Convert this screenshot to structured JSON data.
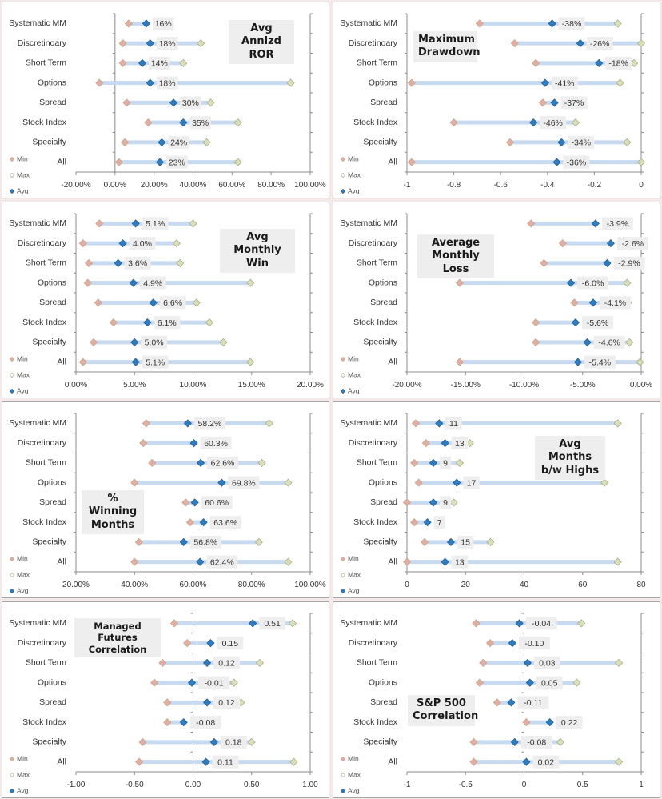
{
  "legend": {
    "min": "Min",
    "max": "Max",
    "avg": "Avg"
  },
  "colors": {
    "min": "#e3aea2",
    "min_edge": "#c9a58a",
    "max": "#d9e0b6",
    "max_edge": "#a8ad8c",
    "avg": "#2f7dbf",
    "range_bar": "#c8daf0",
    "axis": "#8c8c8c"
  },
  "chart_data": [
    {
      "id": "ror",
      "type": "scatter",
      "title": "Avg Annlzd ROR",
      "categories": [
        "Systematic MM",
        "Discretinoary",
        "Short Term",
        "Options",
        "Spread",
        "Stock Index",
        "Specialty",
        "All"
      ],
      "series": [
        {
          "name": "Min",
          "values": [
            0.07,
            0.04,
            0.04,
            -0.08,
            0.06,
            0.17,
            0.05,
            0.02
          ]
        },
        {
          "name": "Max",
          "values": [
            null,
            0.44,
            0.35,
            0.9,
            0.49,
            0.63,
            0.47,
            0.63
          ]
        },
        {
          "name": "Avg",
          "values": [
            0.16,
            0.18,
            0.14,
            0.18,
            0.3,
            0.35,
            0.24,
            0.23
          ]
        }
      ],
      "data_labels": [
        "16%",
        "18%",
        "14%",
        "18%",
        "30%",
        "35%",
        "24%",
        "23%"
      ],
      "xlim": [
        -0.2,
        1.0
      ],
      "ticks": [
        -0.2,
        0,
        0.2,
        0.4,
        0.6,
        0.8,
        1.0
      ],
      "tick_labels": [
        "-20.00%",
        "0.00%",
        "20.00%",
        "40.00%",
        "60.00%",
        "80.00%",
        "100.00%"
      ],
      "zero_line": true
    },
    {
      "id": "drawdown",
      "type": "scatter",
      "title": "Maximum Drawdown",
      "categories": [
        "Systematic MM",
        "Discretinoary",
        "Short Term",
        "Options",
        "Spread",
        "Stock Index",
        "Specialty",
        "All"
      ],
      "series": [
        {
          "name": "Min",
          "values": [
            -0.69,
            -0.54,
            -0.45,
            -0.98,
            -0.42,
            -0.8,
            -0.56,
            -0.98
          ]
        },
        {
          "name": "Max",
          "values": [
            -0.1,
            0.0,
            -0.03,
            -0.09,
            null,
            -0.28,
            -0.06,
            0.0
          ]
        },
        {
          "name": "Avg",
          "values": [
            -0.38,
            -0.26,
            -0.18,
            -0.41,
            -0.37,
            -0.46,
            -0.34,
            -0.36
          ]
        }
      ],
      "data_labels": [
        "-38%",
        "-26%",
        "-18%",
        "-41%",
        "-37%",
        "-46%",
        "-34%",
        "-36%"
      ],
      "xlim": [
        -1,
        0
      ],
      "ticks": [
        -1,
        -0.8,
        -0.6,
        -0.4,
        -0.2,
        0
      ],
      "tick_labels": [
        "-1",
        "-0.8",
        "-0.6",
        "-0.4",
        "-0.2",
        "0"
      ],
      "zero_line": false
    },
    {
      "id": "monthly_win",
      "type": "scatter",
      "title": "Avg Monthly Win",
      "categories": [
        "Systematic MM",
        "Discretinoary",
        "Short Term",
        "Options",
        "Spread",
        "Stock Index",
        "Specialty",
        "All"
      ],
      "series": [
        {
          "name": "Min",
          "values": [
            0.02,
            0.006,
            0.011,
            0.01,
            0.019,
            0.032,
            0.015,
            0.006
          ]
        },
        {
          "name": "Max",
          "values": [
            0.1,
            0.086,
            0.089,
            0.149,
            0.103,
            0.114,
            0.126,
            0.149
          ]
        },
        {
          "name": "Avg",
          "values": [
            0.051,
            0.04,
            0.036,
            0.049,
            0.066,
            0.061,
            0.05,
            0.051
          ]
        }
      ],
      "data_labels": [
        "5.1%",
        "4.0%",
        "3.6%",
        "4.9%",
        "6.6%",
        "6.1%",
        "5.0%",
        "5.1%"
      ],
      "xlim": [
        0,
        0.2
      ],
      "ticks": [
        0,
        0.05,
        0.1,
        0.15,
        0.2
      ],
      "tick_labels": [
        "0.00%",
        "5.00%",
        "10.00%",
        "15.00%",
        "20.00%"
      ],
      "zero_line": false
    },
    {
      "id": "monthly_loss",
      "type": "scatter",
      "title": "Average Monthly Loss",
      "categories": [
        "Systematic MM",
        "Discretinoary",
        "Short Term",
        "Options",
        "Spread",
        "Stock Index",
        "Specialty",
        "All"
      ],
      "series": [
        {
          "name": "Min",
          "values": [
            -0.094,
            -0.067,
            -0.083,
            -0.155,
            -0.057,
            -0.09,
            -0.09,
            -0.155
          ]
        },
        {
          "name": "Max",
          "values": [
            null,
            null,
            null,
            -0.012,
            -0.011,
            null,
            -0.01,
            -0.001
          ]
        },
        {
          "name": "Avg",
          "values": [
            -0.039,
            -0.026,
            -0.029,
            -0.06,
            -0.041,
            -0.056,
            -0.046,
            -0.054
          ]
        }
      ],
      "data_labels": [
        "-3.9%",
        "-2.6%",
        "-2.9%",
        "-6.0%",
        "-4.1%",
        "-5.6%",
        "-4.6%",
        "-5.4%"
      ],
      "xlim": [
        -0.2,
        0
      ],
      "ticks": [
        -0.2,
        -0.15,
        -0.1,
        -0.05,
        0
      ],
      "tick_labels": [
        "-20.00%",
        "-15.00%",
        "-10.00%",
        "-5.00%",
        "0.00%"
      ],
      "zero_line": false
    },
    {
      "id": "winning_months",
      "type": "scatter",
      "title": "% Winning Months",
      "categories": [
        "Systematic MM",
        "Discretinoary",
        "Short Term",
        "Options",
        "Spread",
        "Stock Index",
        "Specialty",
        "All"
      ],
      "series": [
        {
          "name": "Min",
          "values": [
            0.44,
            0.43,
            0.46,
            0.4,
            0.575,
            0.59,
            0.415,
            0.4
          ]
        },
        {
          "name": "Max",
          "values": [
            0.86,
            null,
            0.835,
            0.925,
            null,
            null,
            0.825,
            0.925
          ]
        },
        {
          "name": "Avg",
          "values": [
            0.582,
            0.603,
            0.626,
            0.698,
            0.606,
            0.636,
            0.568,
            0.624
          ]
        }
      ],
      "data_labels": [
        "58.2%",
        "60.3%",
        "62.6%",
        "69.8%",
        "60.6%",
        "63.6%",
        "56.8%",
        "62.4%"
      ],
      "xlim": [
        0.2,
        1.0
      ],
      "ticks": [
        0.2,
        0.4,
        0.6,
        0.8,
        1.0
      ],
      "tick_labels": [
        "20.00%",
        "40.00%",
        "60.00%",
        "80.00%",
        "100.00%"
      ],
      "zero_line": false
    },
    {
      "id": "months_between_highs",
      "type": "scatter",
      "title": "Avg Months b/w Highs",
      "categories": [
        "Systematic MM",
        "Discretinoary",
        "Short Term",
        "Options",
        "Spread",
        "Stock Index",
        "Specialty",
        "All"
      ],
      "series": [
        {
          "name": "Min",
          "values": [
            3,
            6.5,
            2.5,
            4,
            0,
            2.5,
            6,
            0
          ]
        },
        {
          "name": "Max",
          "values": [
            72,
            21.5,
            18,
            67.5,
            16,
            null,
            28.5,
            72
          ]
        },
        {
          "name": "Avg",
          "values": [
            11,
            13,
            9,
            17,
            9,
            7,
            15,
            13
          ]
        }
      ],
      "data_labels": [
        "11",
        "13",
        "9",
        "17",
        "9",
        "7",
        "15",
        "13"
      ],
      "xlim": [
        0,
        80
      ],
      "ticks": [
        0,
        20,
        40,
        60,
        80
      ],
      "tick_labels": [
        "0",
        "20",
        "40",
        "60",
        "80"
      ],
      "zero_line": false
    },
    {
      "id": "mf_correlation",
      "type": "scatter",
      "title": "Managed Futures Correlation",
      "categories": [
        "Systematic MM",
        "Discretinoary",
        "Short Term",
        "Options",
        "Spread",
        "Stock Index",
        "Specialty",
        "All"
      ],
      "series": [
        {
          "name": "Min",
          "values": [
            -0.16,
            -0.05,
            -0.26,
            -0.33,
            -0.22,
            -0.22,
            -0.43,
            -0.46
          ]
        },
        {
          "name": "Max",
          "values": [
            0.85,
            null,
            0.57,
            0.35,
            0.41,
            null,
            0.5,
            0.86
          ]
        },
        {
          "name": "Avg",
          "values": [
            0.51,
            0.15,
            0.12,
            -0.01,
            0.12,
            -0.08,
            0.18,
            0.11
          ]
        }
      ],
      "data_labels": [
        "0.51",
        "0.15",
        "0.12",
        "-0.01",
        "0.12",
        "-0.08",
        "0.18",
        "0.11"
      ],
      "xlim": [
        -1,
        1
      ],
      "ticks": [
        -1,
        -0.5,
        0,
        0.5,
        1
      ],
      "tick_labels": [
        "-1.00",
        "-0.50",
        "0.00",
        "0.50",
        "1.00"
      ],
      "zero_line": true
    },
    {
      "id": "sp500_correlation",
      "type": "scatter",
      "title": "S&P 500 Correlation",
      "categories": [
        "Systematic MM",
        "Discretinoary",
        "Short Term",
        "Options",
        "Spread",
        "Stock Index",
        "Specialty",
        "All"
      ],
      "series": [
        {
          "name": "Min",
          "values": [
            -0.41,
            -0.29,
            -0.35,
            -0.38,
            -0.23,
            0.02,
            -0.43,
            -0.43
          ]
        },
        {
          "name": "Max",
          "values": [
            0.49,
            null,
            0.81,
            0.45,
            null,
            null,
            0.31,
            0.81
          ]
        },
        {
          "name": "Avg",
          "values": [
            -0.04,
            -0.1,
            0.03,
            0.05,
            -0.11,
            0.22,
            -0.08,
            0.02
          ]
        }
      ],
      "data_labels": [
        "-0.04",
        "-0.10",
        "0.03",
        "0.05",
        "-0.11",
        "0.22",
        "-0.08",
        "0.02"
      ],
      "xlim": [
        -1,
        1
      ],
      "ticks": [
        -1,
        -0.5,
        0,
        0.5,
        1
      ],
      "tick_labels": [
        "-1",
        "-0.5",
        "0",
        "0.5",
        "1"
      ],
      "zero_line": true
    }
  ]
}
